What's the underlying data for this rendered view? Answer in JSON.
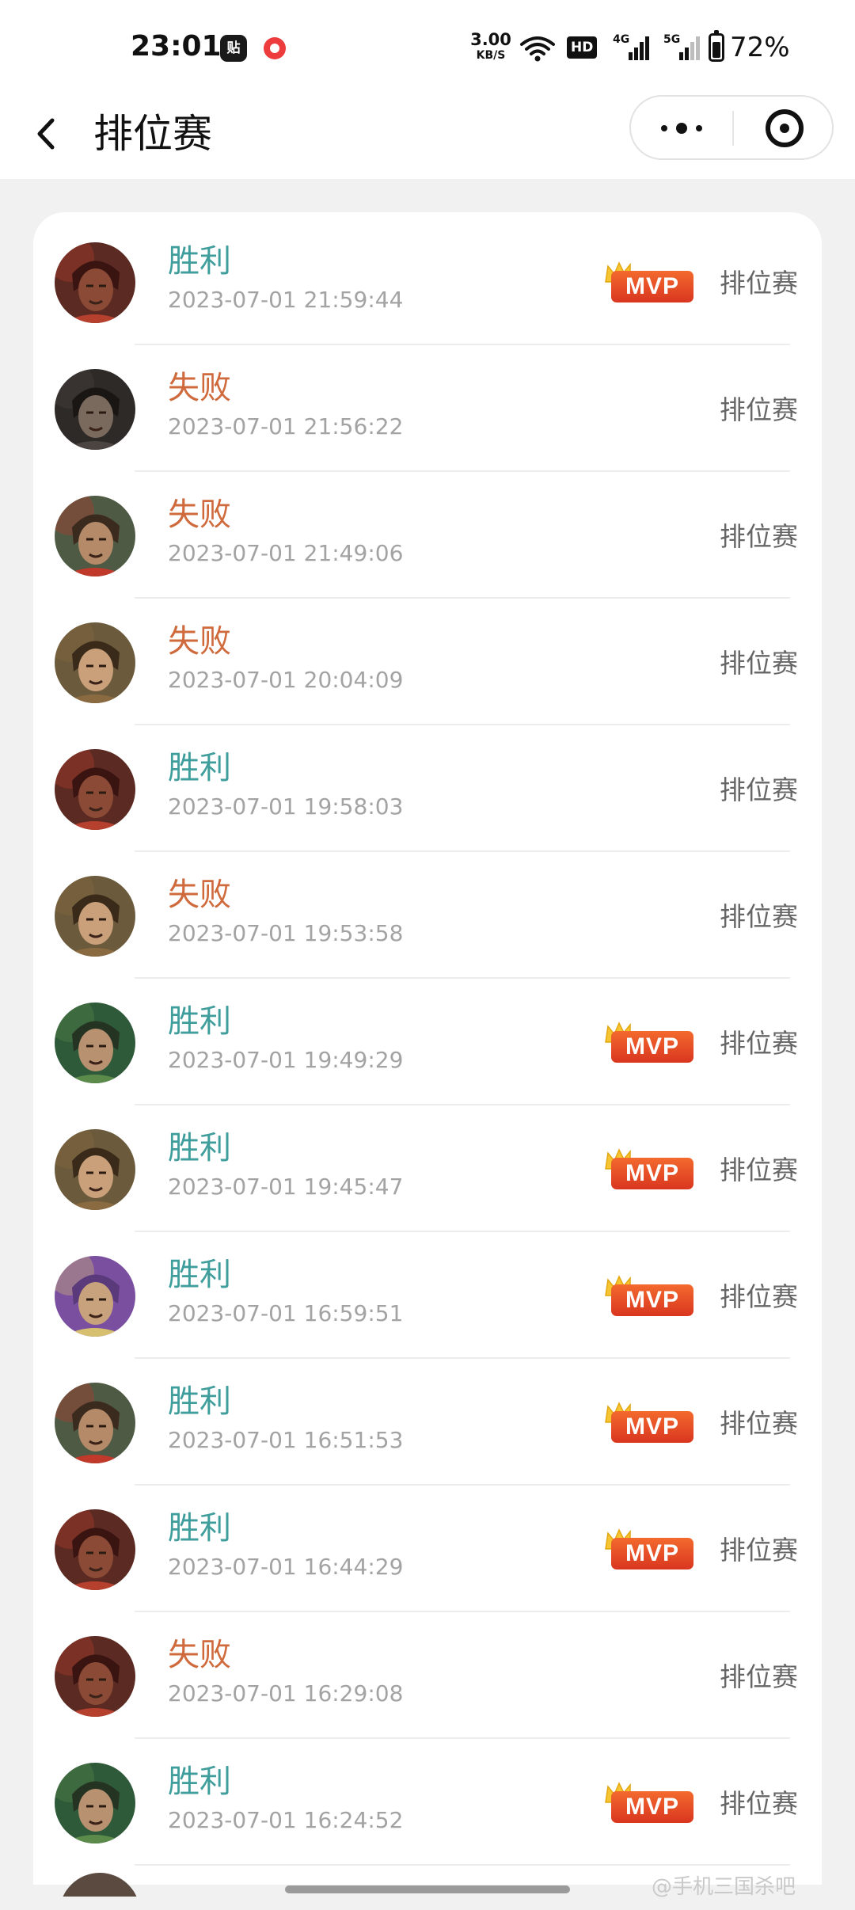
{
  "status_bar": {
    "time": "23:01",
    "app_icon_1": "贴",
    "net_speed_value": "3.00",
    "net_speed_unit": "KB/S",
    "hd_label": "HD",
    "sim1_label": "4G",
    "sim2_label": "5G",
    "battery": "72%"
  },
  "nav": {
    "title": "排位赛",
    "back_icon": "chevron-left-icon",
    "more_icon": "more-dots-icon",
    "target_icon": "target-icon"
  },
  "colors": {
    "win": "#3f9e9c",
    "lose": "#cf6a3c",
    "mvp": "#e5482a"
  },
  "mvp_label": "MVP",
  "records": [
    {
      "result": "胜利",
      "outcome": "win",
      "time": "2023-07-01 21:59:44",
      "mvp": true,
      "mode": "排位赛",
      "avatar": "red-warrior"
    },
    {
      "result": "失败",
      "outcome": "lose",
      "time": "2023-07-01 21:56:22",
      "mvp": false,
      "mode": "排位赛",
      "avatar": "dark-lord"
    },
    {
      "result": "失败",
      "outcome": "lose",
      "time": "2023-07-01 21:49:06",
      "mvp": false,
      "mode": "排位赛",
      "avatar": "red-headband"
    },
    {
      "result": "失败",
      "outcome": "lose",
      "time": "2023-07-01 20:04:09",
      "mvp": false,
      "mode": "排位赛",
      "avatar": "young-hero"
    },
    {
      "result": "胜利",
      "outcome": "win",
      "time": "2023-07-01 19:58:03",
      "mvp": false,
      "mode": "排位赛",
      "avatar": "red-warrior"
    },
    {
      "result": "失败",
      "outcome": "lose",
      "time": "2023-07-01 19:53:58",
      "mvp": false,
      "mode": "排位赛",
      "avatar": "young-hero"
    },
    {
      "result": "胜利",
      "outcome": "win",
      "time": "2023-07-01 19:49:29",
      "mvp": true,
      "mode": "排位赛",
      "avatar": "green-warrior"
    },
    {
      "result": "胜利",
      "outcome": "win",
      "time": "2023-07-01 19:45:47",
      "mvp": true,
      "mode": "排位赛",
      "avatar": "young-hero"
    },
    {
      "result": "胜利",
      "outcome": "win",
      "time": "2023-07-01 16:59:51",
      "mvp": true,
      "mode": "排位赛",
      "avatar": "purple-helmet"
    },
    {
      "result": "胜利",
      "outcome": "win",
      "time": "2023-07-01 16:51:53",
      "mvp": true,
      "mode": "排位赛",
      "avatar": "red-headband"
    },
    {
      "result": "胜利",
      "outcome": "win",
      "time": "2023-07-01 16:44:29",
      "mvp": true,
      "mode": "排位赛",
      "avatar": "red-warrior"
    },
    {
      "result": "失败",
      "outcome": "lose",
      "time": "2023-07-01 16:29:08",
      "mvp": false,
      "mode": "排位赛",
      "avatar": "red-warrior"
    },
    {
      "result": "胜利",
      "outcome": "win",
      "time": "2023-07-01 16:24:52",
      "mvp": true,
      "mode": "排位赛",
      "avatar": "green-warrior"
    }
  ],
  "watermark": "@手机三国杀吧"
}
